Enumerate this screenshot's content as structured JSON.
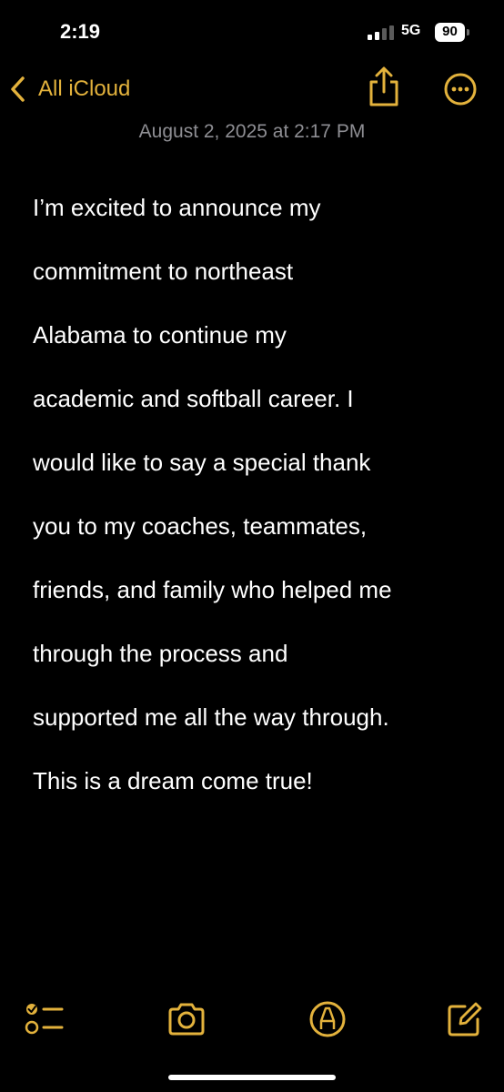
{
  "status_bar": {
    "time": "2:19",
    "network": "5G",
    "battery": "90"
  },
  "nav": {
    "back_label": "All iCloud",
    "share_icon": "share-icon",
    "more_icon": "more-options-icon"
  },
  "note": {
    "date": "August 2, 2025 at 2:17 PM",
    "lines": [
      "I’m excited to announce my",
      "commitment to northeast",
      "Alabama to continue my",
      "academic and softball career. I",
      "would like to say a special thank",
      "you to my coaches, teammates,",
      "friends, and family who helped me",
      "through the process and",
      "supported me all the way through.",
      "This is a dream come true!"
    ]
  },
  "toolbar": {
    "icons": [
      "checklist-icon",
      "camera-icon",
      "markup-icon",
      "compose-icon"
    ]
  },
  "colors": {
    "accent": "#e3b23c",
    "background": "#000000",
    "text": "#ffffff",
    "secondary_text": "#8e8e93"
  }
}
